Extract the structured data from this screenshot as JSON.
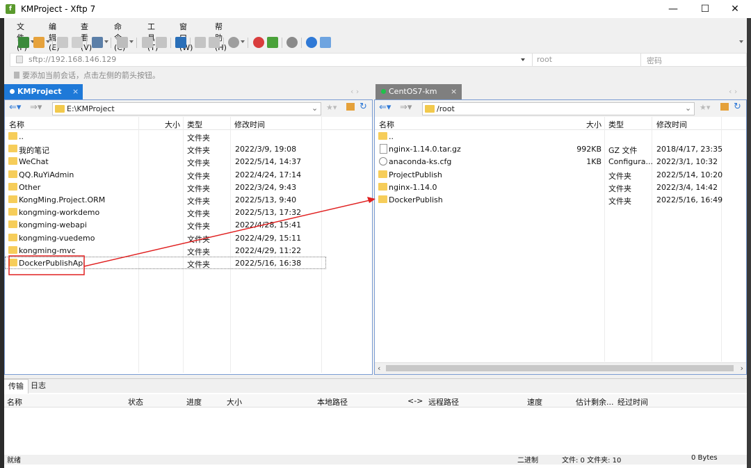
{
  "window": {
    "title": "KMProject - Xftp 7",
    "minimize": "—",
    "maximize": "☐",
    "close": "✕"
  },
  "menu": [
    "文件(F)",
    "编辑(E)",
    "查看(V)",
    "命令(C)",
    "工具(T)",
    "窗口(W)",
    "帮助(H)"
  ],
  "toolbar": {
    "icons": [
      "new-session-icon",
      "open-folder-icon",
      "connect-icon",
      "disconnect-icon",
      "new-window-icon",
      "terminal-icon",
      "copy-icon",
      "paste-icon",
      "transfer-icon",
      "find-icon",
      "find2-icon",
      "record-icon",
      "xshell-icon",
      "xftp-icon",
      "settings-icon",
      "help-icon",
      "chat-icon"
    ]
  },
  "address": {
    "value": "sftp://192.168.146.129",
    "user_placeholder": "root",
    "pass_placeholder": "密码"
  },
  "hint": "要添加当前会话，点击左侧的箭头按钮。",
  "left": {
    "tab_label": "KMProject",
    "tab_close": "×",
    "path": "E:\\KMProject",
    "columns": {
      "name": "名称",
      "size": "大小",
      "type": "类型",
      "modified": "修改时间"
    },
    "rows": [
      {
        "name": "..",
        "size": "",
        "type": "文件夹",
        "modified": ""
      },
      {
        "name": "我的笔记",
        "size": "",
        "type": "文件夹",
        "modified": "2022/3/9, 19:08"
      },
      {
        "name": "WeChat",
        "size": "",
        "type": "文件夹",
        "modified": "2022/5/14, 14:37"
      },
      {
        "name": "QQ.RuYiAdmin",
        "size": "",
        "type": "文件夹",
        "modified": "2022/4/24, 17:14"
      },
      {
        "name": "Other",
        "size": "",
        "type": "文件夹",
        "modified": "2022/3/24, 9:43"
      },
      {
        "name": "KongMing.Project.ORM",
        "size": "",
        "type": "文件夹",
        "modified": "2022/5/13, 9:40"
      },
      {
        "name": "kongming-workdemo",
        "size": "",
        "type": "文件夹",
        "modified": "2022/5/13, 17:32"
      },
      {
        "name": "kongming-webapi",
        "size": "",
        "type": "文件夹",
        "modified": "2022/4/28, 15:41"
      },
      {
        "name": "kongming-vuedemo",
        "size": "",
        "type": "文件夹",
        "modified": "2022/4/29, 15:11"
      },
      {
        "name": "kongming-mvc",
        "size": "",
        "type": "文件夹",
        "modified": "2022/4/29, 11:22"
      },
      {
        "name": "DockerPublishApi",
        "size": "",
        "type": "文件夹",
        "modified": "2022/5/16, 16:38"
      }
    ]
  },
  "right": {
    "tab_label": "CentOS7-km",
    "tab_close": "×",
    "path": "/root",
    "columns": {
      "name": "名称",
      "size": "大小",
      "type": "类型",
      "modified": "修改时间"
    },
    "rows": [
      {
        "name": "..",
        "size": "",
        "type": "",
        "modified": "",
        "icon": "folder"
      },
      {
        "name": "nginx-1.14.0.tar.gz",
        "size": "992KB",
        "type": "GZ 文件",
        "modified": "2018/4/17, 23:35",
        "icon": "doc"
      },
      {
        "name": "anaconda-ks.cfg",
        "size": "1KB",
        "type": "Configura...",
        "modified": "2022/3/1, 10:32",
        "icon": "cfg"
      },
      {
        "name": "ProjectPublish",
        "size": "",
        "type": "文件夹",
        "modified": "2022/5/14, 10:20",
        "icon": "folder"
      },
      {
        "name": "nginx-1.14.0",
        "size": "",
        "type": "文件夹",
        "modified": "2022/3/4, 14:42",
        "icon": "folder"
      },
      {
        "name": "DockerPublish",
        "size": "",
        "type": "文件夹",
        "modified": "2022/5/16, 16:49",
        "icon": "folder"
      }
    ]
  },
  "transfer": {
    "tabs": [
      "传输",
      "日志"
    ],
    "columns": [
      "名称",
      "状态",
      "进度",
      "大小",
      "本地路径",
      "<->",
      "远程路径",
      "速度",
      "估计剩余...",
      "经过时间"
    ]
  },
  "status": {
    "ready": "就绪",
    "mode": "二进制",
    "files": "文件: 0  文件夹: 10",
    "bytes": "0 Bytes"
  },
  "colors": {
    "accent": "#1e79d8",
    "tab_inactive": "#7f7f7f",
    "folder": "#f6cd5a",
    "annotation": "#e02020"
  }
}
